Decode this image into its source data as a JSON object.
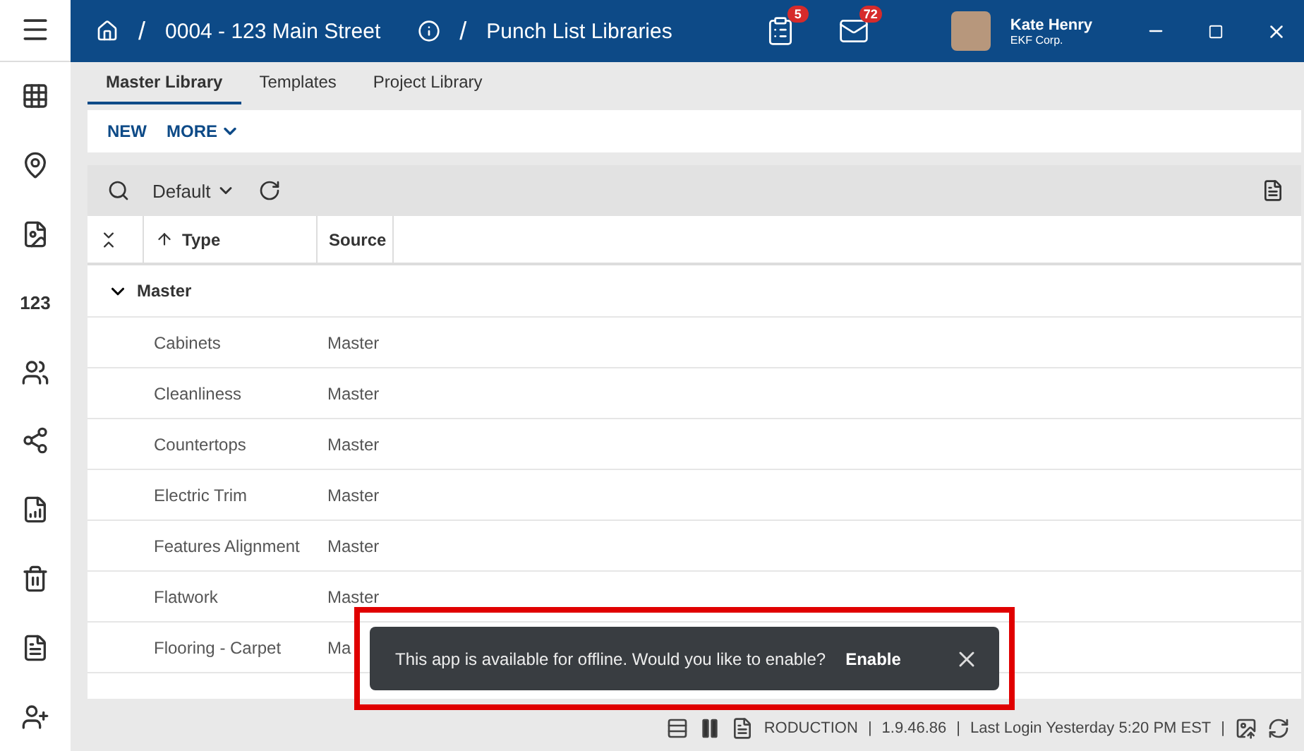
{
  "breadcrumb": {
    "separator": "/",
    "project": "0004 - 123 Main Street",
    "page": "Punch List Libraries"
  },
  "notifications": [
    {
      "kind": "list",
      "count": "5"
    },
    {
      "kind": "mail",
      "count": "72"
    }
  ],
  "user": {
    "name": "Kate Henry",
    "company": "EKF Corp."
  },
  "sidebar": {
    "items": [
      {
        "kind": "apps"
      },
      {
        "kind": "pin"
      },
      {
        "kind": "photos"
      },
      {
        "kind": "numbers",
        "label": "123"
      },
      {
        "kind": "people"
      },
      {
        "kind": "share"
      },
      {
        "kind": "report"
      },
      {
        "kind": "bin"
      },
      {
        "kind": "file"
      },
      {
        "kind": "add-user"
      }
    ]
  },
  "tabs": [
    {
      "label": "Master Library",
      "selected": true
    },
    {
      "label": "Templates",
      "selected": false
    },
    {
      "label": "Project Library",
      "selected": false
    }
  ],
  "actions": {
    "new": "NEW",
    "more": "MORE"
  },
  "grid": {
    "view": "Default",
    "columns": [
      "Type",
      "Source"
    ],
    "group": {
      "label": "Master",
      "expanded": true
    },
    "rows": [
      {
        "type": "Cabinets",
        "source": "Master"
      },
      {
        "type": "Cleanliness",
        "source": "Master"
      },
      {
        "type": "Countertops",
        "source": "Master"
      },
      {
        "type": "Electric Trim",
        "source": "Master"
      },
      {
        "type": "Features Alignment",
        "source": "Master"
      },
      {
        "type": "Flatwork",
        "source": "Master"
      },
      {
        "type": "Flooring - Carpet",
        "source": "Ma"
      }
    ]
  },
  "toast": {
    "message": "This app is available for offline. Would you like to enable?",
    "action": "Enable"
  },
  "status_bar": {
    "items": [
      "RODUCTION",
      "|",
      "1.9.46.86",
      "|",
      "Last Login Yesterday 5:20 PM EST",
      "|"
    ]
  }
}
